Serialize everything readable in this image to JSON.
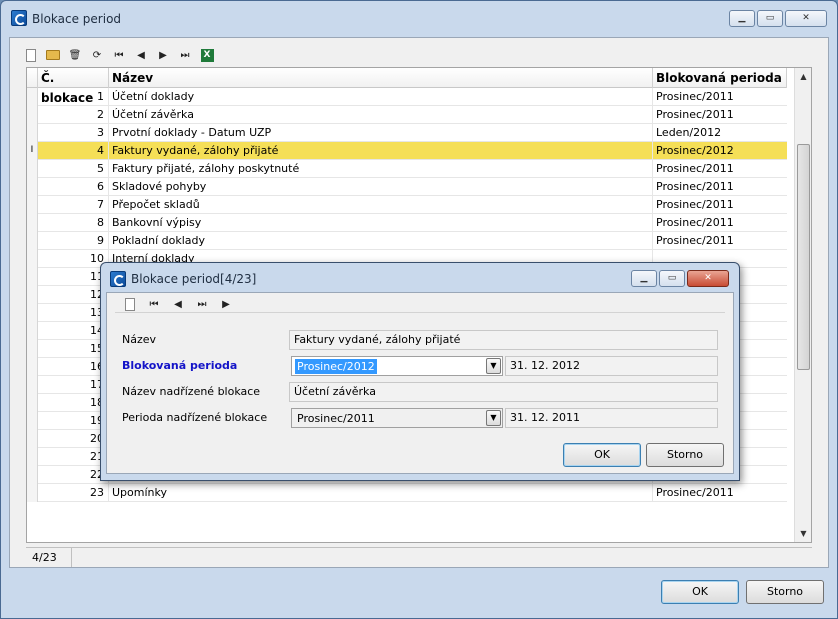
{
  "window": {
    "title": "Blokace period"
  },
  "toolbar": {
    "excel_glyph": "X"
  },
  "grid": {
    "columns": {
      "number": "Č. blokace",
      "name": "Název",
      "period": "Blokovaná perioda"
    },
    "rows": [
      {
        "num": "1",
        "name": "Účetní doklady",
        "period": "Prosinec/2011"
      },
      {
        "num": "2",
        "name": "Účetní závěrka",
        "period": "Prosinec/2011"
      },
      {
        "num": "3",
        "name": "Prvotní doklady - Datum UZP",
        "period": "Leden/2012"
      },
      {
        "num": "4",
        "name": "Faktury vydané, zálohy přijaté",
        "period": "Prosinec/2012"
      },
      {
        "num": "5",
        "name": "Faktury přijaté, zálohy poskytnuté",
        "period": "Prosinec/2011"
      },
      {
        "num": "6",
        "name": "Skladové pohyby",
        "period": "Prosinec/2011"
      },
      {
        "num": "7",
        "name": "Přepočet skladů",
        "period": "Prosinec/2011"
      },
      {
        "num": "8",
        "name": "Bankovní výpisy",
        "period": "Prosinec/2011"
      },
      {
        "num": "9",
        "name": "Pokladní doklady",
        "period": "Prosinec/2011"
      },
      {
        "num": "10",
        "name": "Interní doklady",
        "period": ""
      },
      {
        "num": "11",
        "name": "",
        "period": ""
      },
      {
        "num": "12",
        "name": "",
        "period": ""
      },
      {
        "num": "13",
        "name": "",
        "period": ""
      },
      {
        "num": "14",
        "name": "",
        "period": ""
      },
      {
        "num": "15",
        "name": "",
        "period": ""
      },
      {
        "num": "16",
        "name": "",
        "period": ""
      },
      {
        "num": "17",
        "name": "",
        "period": ""
      },
      {
        "num": "18",
        "name": "",
        "period": ""
      },
      {
        "num": "19",
        "name": "",
        "period": ""
      },
      {
        "num": "20",
        "name": "",
        "period": ""
      },
      {
        "num": "21",
        "name": "",
        "period": ""
      },
      {
        "num": "22",
        "name": "",
        "period": ""
      },
      {
        "num": "23",
        "name": "Upomínky",
        "period": "Prosinec/2011"
      }
    ],
    "selected_row": 3,
    "row_marker": "I"
  },
  "status": {
    "position": "4/23"
  },
  "buttons": {
    "ok": "OK",
    "cancel": "Storno"
  },
  "dialog": {
    "title": "Blokace period[4/23]",
    "fields": {
      "name_label": "Název",
      "name_value": "Faktury vydané, zálohy přijaté",
      "period_label": "Blokovaná perioda",
      "period_value": "Prosinec/2012",
      "period_date": "31. 12. 2012",
      "parent_name_label": "Název nadřízené blokace",
      "parent_name_value": "Účetní závěrka",
      "parent_period_label": "Perioda nadřízené blokace",
      "parent_period_value": "Prosinec/2011",
      "parent_period_date": "31. 12. 2011"
    },
    "buttons": {
      "ok": "OK",
      "cancel": "Storno"
    }
  },
  "colors": {
    "selection": "#f5df57",
    "required_label": "#1414c8",
    "highlight": "#3399ff"
  }
}
